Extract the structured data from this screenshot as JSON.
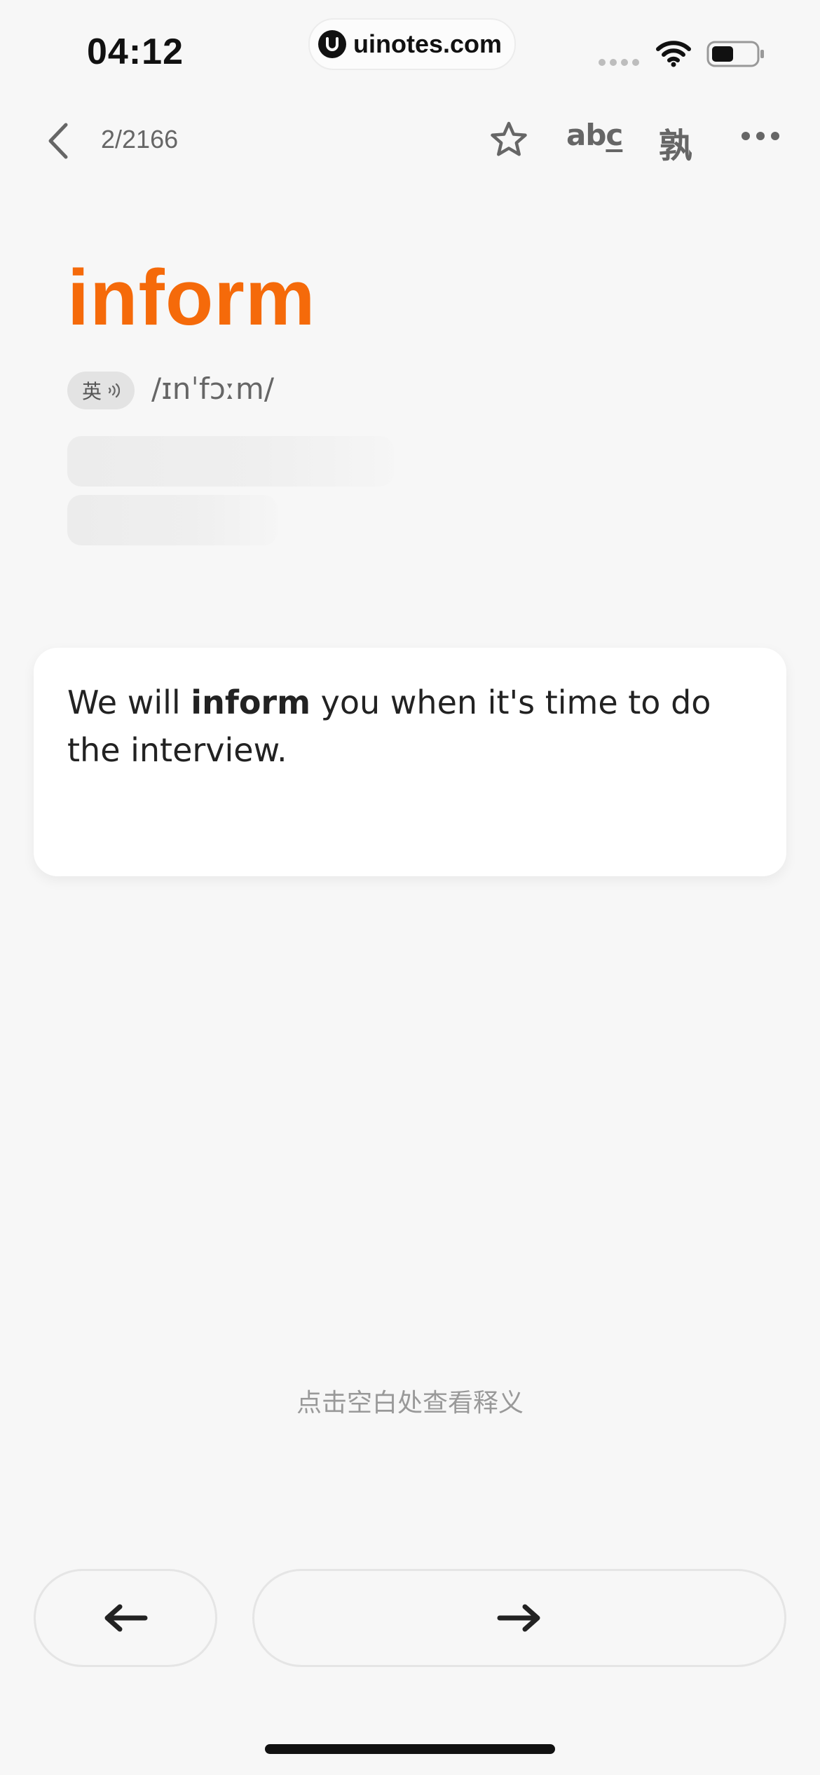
{
  "status_bar": {
    "time": "04:12",
    "watermark": "uinotes.com"
  },
  "nav": {
    "progress": "2/2166",
    "abc_label_main": "ab",
    "abc_label_under": "c",
    "familiar_label": "孰"
  },
  "word": {
    "text": "inform",
    "accent_label": "英",
    "phonetic": "/ɪnˈfɔːm/"
  },
  "example": {
    "before": "We will ",
    "highlight": "inform",
    "after": " you when it's time to do the interview."
  },
  "hint": "点击空白处查看释义",
  "colors": {
    "accent": "#f56a0a",
    "background": "#f7f7f7",
    "card": "#ffffff"
  },
  "icons": {
    "back": "chevron-left-icon",
    "favorite": "star-icon",
    "more": "more-dots-icon",
    "audio": "speaker-icon",
    "prev": "arrow-left-icon",
    "next": "arrow-right-icon"
  }
}
